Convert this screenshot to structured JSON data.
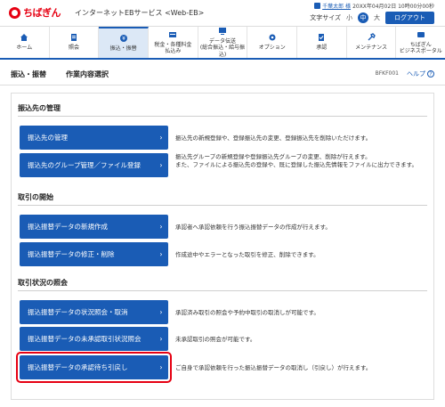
{
  "header": {
    "brand": "ちばぎん",
    "service": "インターネットEBサービス <Web-EB>",
    "user_name": "千葉太郎 様",
    "login_time": "20XX年04月02日 10時00分00秒",
    "font_size_label": "文字サイズ",
    "font_small": "小",
    "font_medium": "中",
    "font_large": "大",
    "logout": "ログアウト"
  },
  "nav": {
    "items": [
      {
        "label": "ホーム",
        "icon": "home-icon"
      },
      {
        "label": "照会",
        "icon": "document-icon"
      },
      {
        "label": "振込・振替",
        "icon": "transfer-icon",
        "active": true
      },
      {
        "label": "税金・各種料金\n払込み",
        "icon": "tax-icon"
      },
      {
        "label": "データ伝送\n(総合振込・給与振込)",
        "icon": "data-transmission-icon"
      },
      {
        "label": "オプション",
        "icon": "gear-icon"
      },
      {
        "label": "承認",
        "icon": "approval-icon"
      },
      {
        "label": "メンテナンス",
        "icon": "maintenance-icon"
      },
      {
        "label": "ちばぎん\nビジネスポータル",
        "icon": "portal-icon"
      }
    ]
  },
  "page": {
    "breadcrumb": "振込・振替",
    "title": "作業内容選択",
    "screen_id": "BFKF001",
    "help": "ヘルプ"
  },
  "sections": {
    "payee": {
      "heading": "振込先の管理",
      "btn1": "振込先の管理",
      "desc1": "振込先の新規登録や、登録振込先の変更、登録振込先を削除いただけます。",
      "btn2": "振込先のグループ管理／ファイル登録",
      "desc2a": "振込先グループの新規登録や登録振込先グループの変更、削除が行えます。",
      "desc2b": "また、ファイルによる振込先の登録や、既に登録した振込先情報をファイルに出力できます。"
    },
    "start": {
      "heading": "取引の開始",
      "btn1": "振込振替データの新規作成",
      "desc1": "承認者へ承認依頼を行う振込振替データの作成が行えます。",
      "btn2": "振込振替データの修正・削除",
      "desc2": "作成途中やエラーとなった取引を修正、削除できます。"
    },
    "status": {
      "heading": "取引状況の照会",
      "btn1": "振込振替データの状況照会・取消",
      "desc1": "承認済み取引の照会や予約中取引の取消しが可能です。",
      "btn2": "振込振替データの未承認取引状況照会",
      "desc2": "未承認取引の照会が可能です。",
      "btn3": "振込振替データの承認待ち引戻し",
      "desc3": "ご自身で承認依頼を行った振込振替データの取消し（引戻し）が行えます。"
    }
  },
  "colors": {
    "accent": "#1a5cb5",
    "brand_red": "#e60012",
    "active_tab_bg": "#dce8f6"
  }
}
